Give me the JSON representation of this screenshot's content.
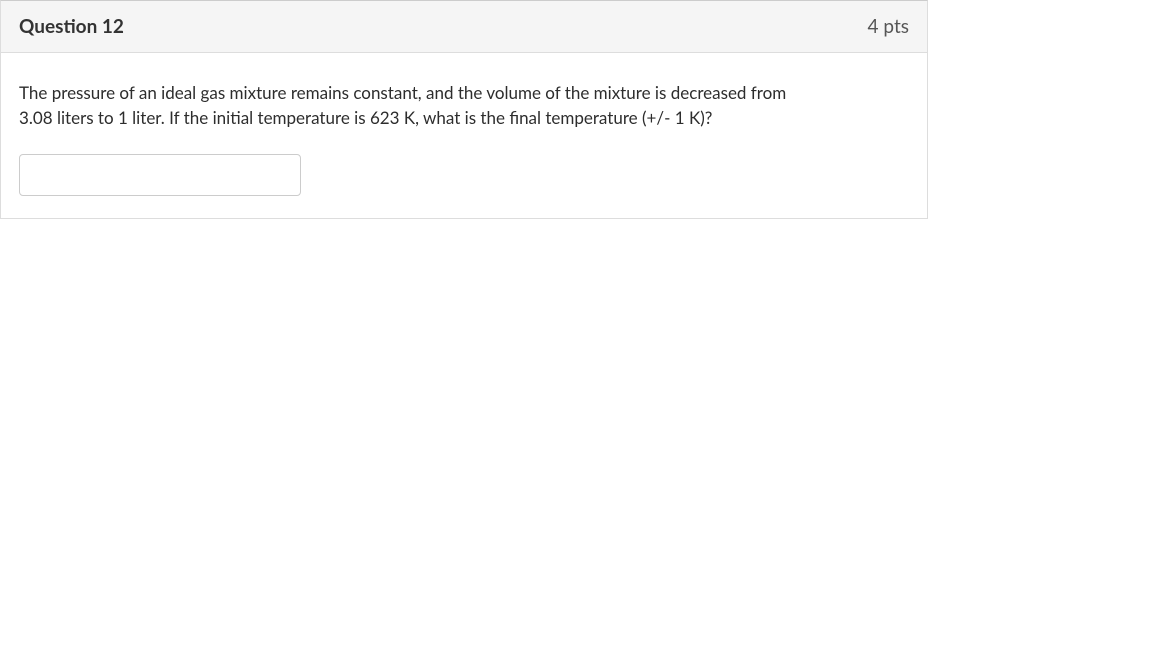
{
  "header": {
    "title": "Question 12",
    "points": "4 pts"
  },
  "body": {
    "text_line1": "The pressure of an ideal gas mixture remains constant, and the volume of the mixture is decreased from",
    "text_line2": "3.08 liters to 1 liter. If the initial temperature is 623 K, what is the final temperature (+/- 1 K)?",
    "answer_value": ""
  }
}
